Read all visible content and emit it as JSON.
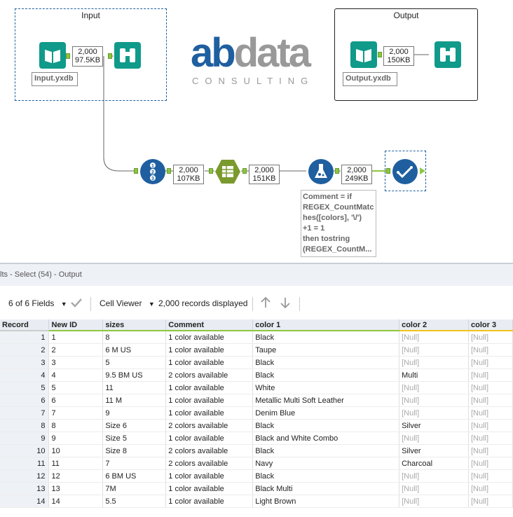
{
  "canvas": {
    "input_container": {
      "title": "Input"
    },
    "output_container": {
      "title": "Output"
    },
    "logo": {
      "part1": "ab",
      "part2": "data",
      "sub": "CONSULTING"
    },
    "input_stat": {
      "records": "2,000",
      "size": "97.5KB"
    },
    "input_label": "Input.yxdb",
    "output_stat": {
      "records": "2,000",
      "size": "150KB"
    },
    "output_label": "Output.yxdb",
    "recordid_stat": {
      "records": "2,000",
      "size": "107KB"
    },
    "text_stat": {
      "records": "2,000",
      "size": "151KB"
    },
    "formula_stat": {
      "records": "2,000",
      "size": "249KB"
    },
    "formula_comment": [
      "Comment = if",
      "REGEX_CountMatc",
      "hes([colors], '\\/')",
      "+1 = 1",
      "then tostring",
      "(REGEX_CountM..."
    ],
    "colors": {
      "accent_blue": "#1f5fa0",
      "tool_teal": "#0f9a8a",
      "tool_olive": "#7a9a2e",
      "connector_green": "#8dc63f"
    }
  },
  "results": {
    "title": "lts - Select (54) - Output",
    "fields_label": "6 of 6 Fields",
    "viewer_label": "Cell Viewer",
    "records_displayed": "2,000 records displayed"
  },
  "table": {
    "columns": [
      "Record",
      "New ID",
      "sizes",
      "Comment",
      "color 1",
      "color 2",
      "color 3"
    ],
    "rows": [
      [
        "1",
        "1",
        "8",
        "1 color available",
        "Black",
        "[Null]",
        "[Null]"
      ],
      [
        "2",
        "2",
        "6 M US",
        "1 color available",
        "Taupe",
        "[Null]",
        "[Null]"
      ],
      [
        "3",
        "3",
        "5",
        "1 color available",
        "Black",
        "[Null]",
        "[Null]"
      ],
      [
        "4",
        "4",
        "9.5 BM US",
        "2 colors available",
        "Black",
        "Multi",
        "[Null]"
      ],
      [
        "5",
        "5",
        "11",
        "1 color available",
        "White",
        "[Null]",
        "[Null]"
      ],
      [
        "6",
        "6",
        "11 M",
        "1 color available",
        "Metallic Multi Soft Leather",
        "[Null]",
        "[Null]"
      ],
      [
        "7",
        "7",
        "9",
        "1 color available",
        "Denim Blue",
        "[Null]",
        "[Null]"
      ],
      [
        "8",
        "8",
        "Size 6",
        "2 colors available",
        "Black",
        "Silver",
        "[Null]"
      ],
      [
        "9",
        "9",
        "Size 5",
        "1 color available",
        "Black and White Combo",
        "[Null]",
        "[Null]"
      ],
      [
        "10",
        "10",
        "Size 8",
        "2 colors available",
        "Black",
        "Silver",
        "[Null]"
      ],
      [
        "11",
        "11",
        "7",
        "2 colors available",
        "Navy",
        "Charcoal",
        "[Null]"
      ],
      [
        "12",
        "12",
        "6 BM US",
        "1 color available",
        "Black",
        "[Null]",
        "[Null]"
      ],
      [
        "13",
        "13",
        "7M",
        "1 color available",
        "Black Multi",
        "[Null]",
        "[Null]"
      ],
      [
        "14",
        "14",
        "5.5",
        "1 color available",
        "Light Brown",
        "[Null]",
        "[Null]"
      ]
    ]
  }
}
